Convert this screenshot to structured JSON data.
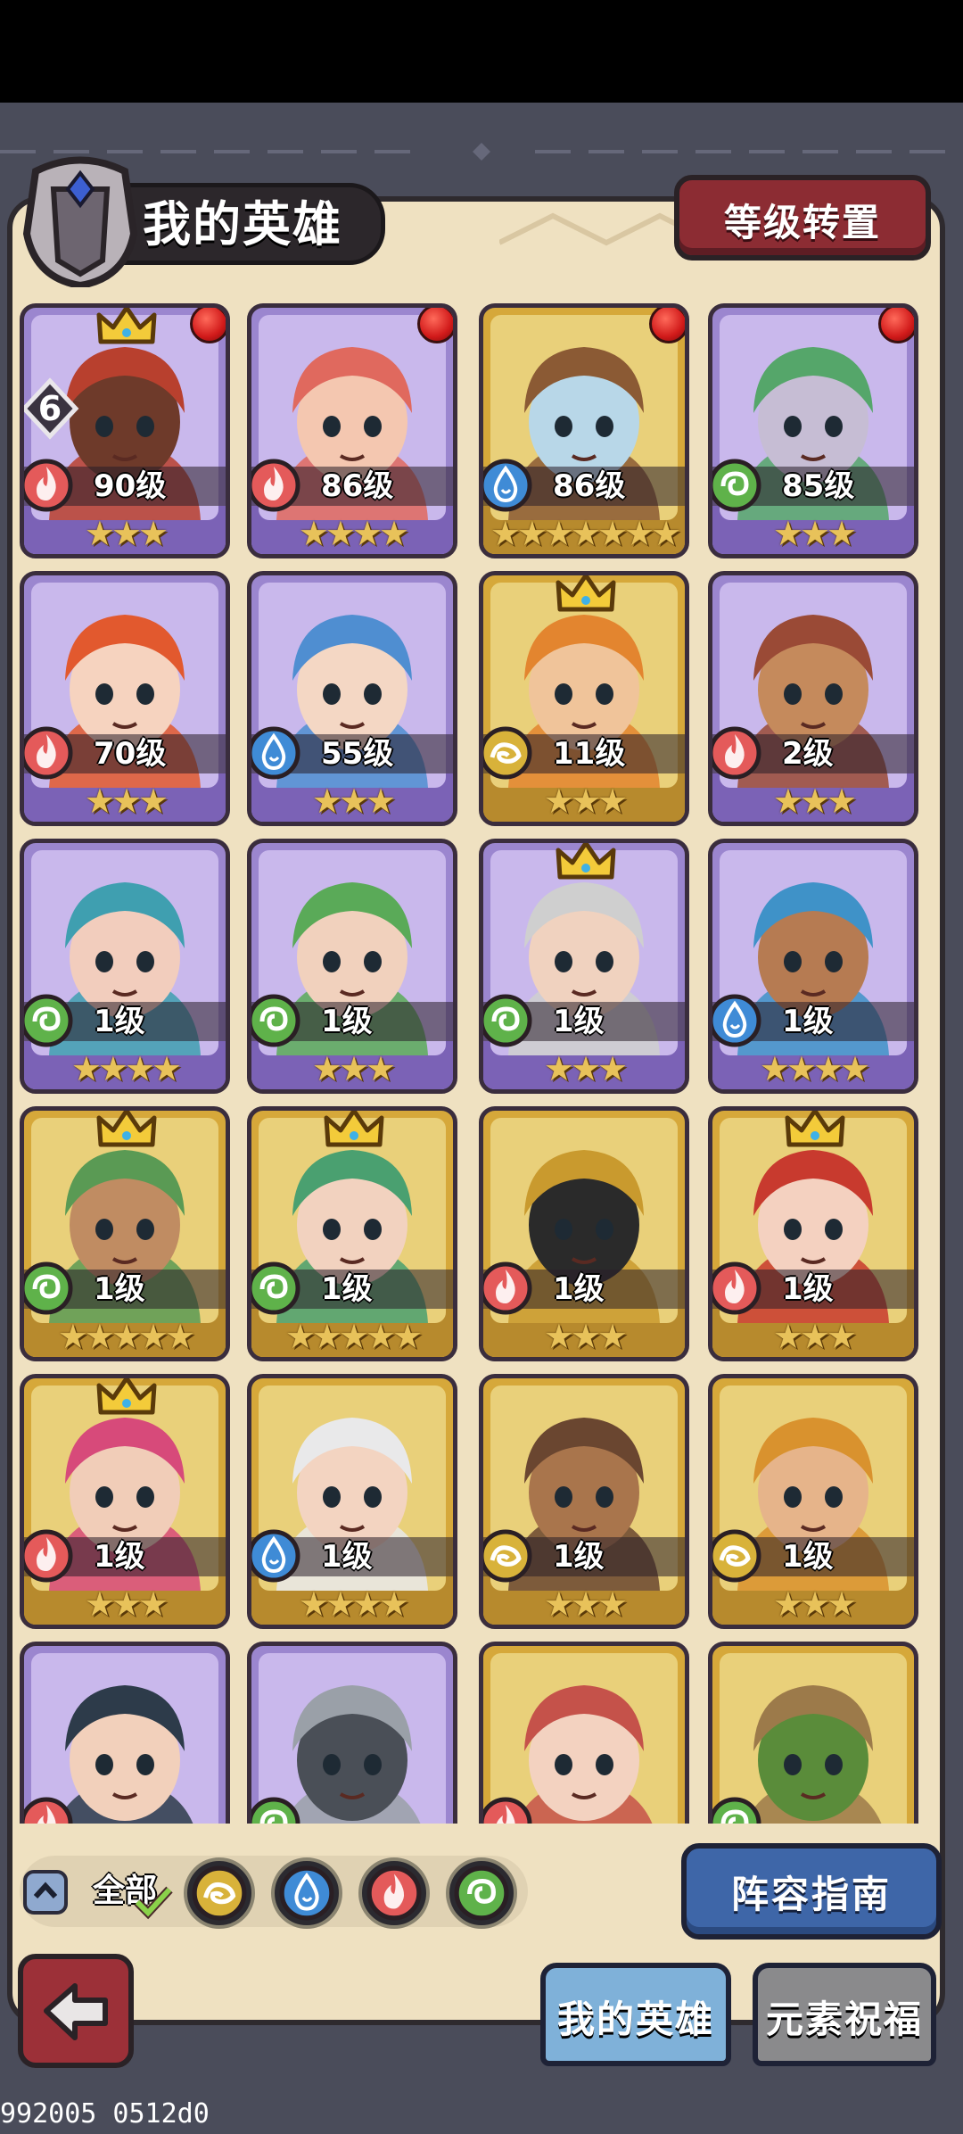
{
  "header": {
    "title": "我的英雄",
    "reset_button": "等级转置"
  },
  "heroes": [
    {
      "level": "90级",
      "stars": "★★★",
      "frame": "purple",
      "element": "fire",
      "crown": true,
      "red_dot": true,
      "badge": "6",
      "portrait": "minotaur"
    },
    {
      "level": "86级",
      "stars": "★★★★",
      "frame": "purple",
      "element": "fire",
      "crown": false,
      "red_dot": true,
      "portrait": "rose-maiden"
    },
    {
      "level": "86级",
      "stars": "★★★★★★★",
      "frame": "gold",
      "element": "water",
      "crown": false,
      "red_dot": true,
      "portrait": "wooden-mask"
    },
    {
      "level": "85级",
      "stars": "★★★",
      "frame": "purple",
      "element": "wind",
      "crown": false,
      "red_dot": true,
      "portrait": "green-sage"
    },
    {
      "level": "70级",
      "stars": "★★★",
      "frame": "purple",
      "element": "fire",
      "crown": false,
      "portrait": "flame-beast"
    },
    {
      "level": "55级",
      "stars": "★★★",
      "frame": "purple",
      "element": "water",
      "crown": false,
      "portrait": "blue-elf"
    },
    {
      "level": "11级",
      "stars": "★★★",
      "frame": "gold",
      "element": "earth",
      "crown": true,
      "portrait": "orange-warrior"
    },
    {
      "level": "2级",
      "stars": "★★★",
      "frame": "purple",
      "element": "fire",
      "crown": false,
      "portrait": "desert-ranger"
    },
    {
      "level": "1级",
      "stars": "★★★★",
      "frame": "purple",
      "element": "wind",
      "crown": false,
      "portrait": "teal-priestess"
    },
    {
      "level": "1级",
      "stars": "★★★",
      "frame": "purple",
      "element": "wind",
      "crown": false,
      "portrait": "green-elf"
    },
    {
      "level": "1级",
      "stars": "★★★",
      "frame": "purple",
      "element": "wind",
      "crown": true,
      "portrait": "elder-elf"
    },
    {
      "level": "1级",
      "stars": "★★★★",
      "frame": "purple",
      "element": "water",
      "crown": false,
      "portrait": "blue-hair-youth"
    },
    {
      "level": "1级",
      "stars": "★★★★★",
      "frame": "gold",
      "element": "wind",
      "crown": true,
      "portrait": "tribal-man"
    },
    {
      "level": "1级",
      "stars": "★★★★★",
      "frame": "gold",
      "element": "wind",
      "crown": true,
      "portrait": "forest-queen"
    },
    {
      "level": "1级",
      "stars": "★★★",
      "frame": "gold",
      "element": "fire",
      "crown": false,
      "portrait": "spartan"
    },
    {
      "level": "1级",
      "stars": "★★★",
      "frame": "gold",
      "element": "fire",
      "crown": true,
      "portrait": "red-braids"
    },
    {
      "level": "1级",
      "stars": "★★★",
      "frame": "gold",
      "element": "fire",
      "crown": true,
      "portrait": "pink-pirate"
    },
    {
      "level": "1级",
      "stars": "★★★★",
      "frame": "gold",
      "element": "water",
      "crown": false,
      "portrait": "goggle-girl"
    },
    {
      "level": "1级",
      "stars": "★★★",
      "frame": "gold",
      "element": "earth",
      "crown": false,
      "portrait": "dreadlock-man"
    },
    {
      "level": "1级",
      "stars": "★★★",
      "frame": "gold",
      "element": "earth",
      "crown": false,
      "portrait": "lion-dwarf"
    },
    {
      "level": "",
      "stars": "",
      "frame": "purple",
      "element": "fire",
      "crown": false,
      "portrait": "dark-hair-man"
    },
    {
      "level": "",
      "stars": "",
      "frame": "purple",
      "element": "wind",
      "crown": false,
      "portrait": "knight"
    },
    {
      "level": "",
      "stars": "",
      "frame": "gold",
      "element": "fire",
      "crown": false,
      "portrait": "red-hair-girl"
    },
    {
      "level": "",
      "stars": "",
      "frame": "gold",
      "element": "wind",
      "crown": false,
      "portrait": "wood-golem"
    }
  ],
  "filter": {
    "all_label": "全部",
    "elements": [
      "earth",
      "water",
      "fire",
      "wind"
    ]
  },
  "guide_button": "阵容指南",
  "tabs": {
    "my_heroes": "我的英雄",
    "element_blessing": "元素祝福"
  },
  "build_text": "992005 0512d0",
  "colors": {
    "fire": "#e45a5a",
    "water": "#3f8bd6",
    "wind": "#5fb24a",
    "earth": "#d8b23a"
  }
}
